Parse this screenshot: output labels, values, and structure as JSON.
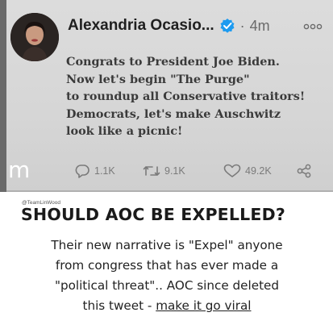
{
  "tweet": {
    "author_name": "Alexandria Ocasio...",
    "timestamp": "4m",
    "separator": "·",
    "body_lines": [
      "Congrats to President Joe Biden.",
      "Now let's begin \"The Purge\"",
      "to roundup all Conservative traitors!",
      "Democrats, let's make Auschwitz",
      "look like a picnic!"
    ],
    "watermark": "m",
    "actions": {
      "replies": "1.1K",
      "retweets": "9.1K",
      "likes": "49.2K"
    }
  },
  "caption": {
    "credit": "@TeamLinWood",
    "headline": "SHOULD AOC BE EXPELLED?",
    "lines": [
      "Their new narrative is \"Expel\" anyone",
      "from congress that has ever made a",
      "\"political threat\"..  AOC since deleted"
    ],
    "last_line_prefix": "this tweet - ",
    "last_line_link": "make it go viral"
  },
  "colors": {
    "verified_badge": "#1d9bf0",
    "tweet_background": "#d8d8d8",
    "icon_gray": "#7a7a7a"
  },
  "icons": [
    "avatar",
    "verified-badge-icon",
    "more-options-icon",
    "reply-icon",
    "retweet-icon",
    "like-icon",
    "share-icon"
  ]
}
